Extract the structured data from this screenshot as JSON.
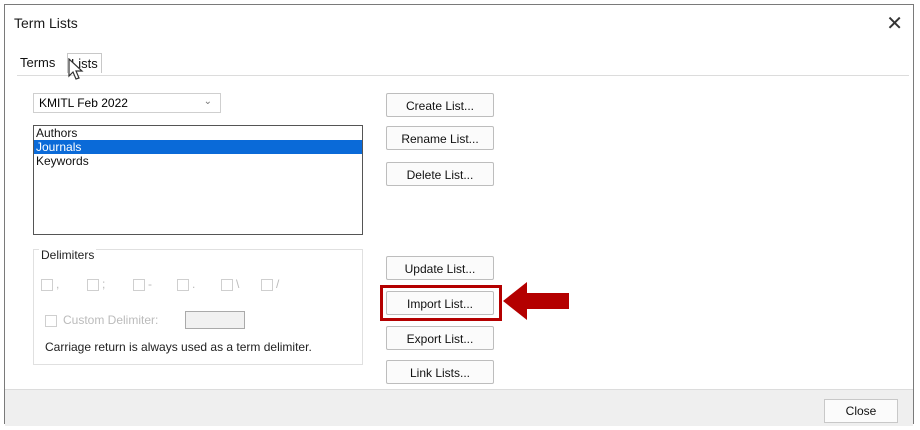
{
  "window": {
    "title": "Term Lists",
    "close_glyph": "✕"
  },
  "tabs": [
    {
      "label": "Terms"
    },
    {
      "label": "Lists"
    }
  ],
  "library_select": {
    "value": "KMITL Feb 2022"
  },
  "lists": {
    "items": [
      "Authors",
      "Journals",
      "Keywords"
    ],
    "selected": "Journals"
  },
  "delimiters": {
    "legend": "Delimiters",
    "options": [
      ",",
      ";",
      "-",
      ".",
      "\\",
      "/"
    ],
    "custom_label": "Custom Delimiter:",
    "note": "Carriage return is always used as a term delimiter."
  },
  "buttons": {
    "create": "Create List...",
    "rename": "Rename List...",
    "delete": "Delete List...",
    "update": "Update List...",
    "import": "Import List...",
    "export": "Export List...",
    "link": "Link Lists..."
  },
  "footer": {
    "close": "Close"
  },
  "colors": {
    "selection": "#0a6ad8",
    "highlight": "#b40000"
  }
}
